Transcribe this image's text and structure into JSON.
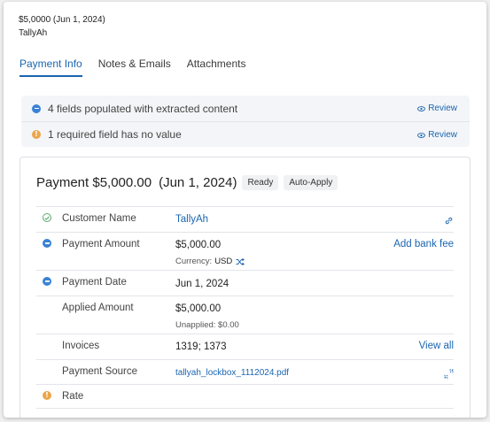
{
  "header": {
    "amount_line": "$5,0000 (Jun 1, 2024)",
    "customer": "TallyAh"
  },
  "tabs": [
    {
      "label": "Payment Info",
      "active": true
    },
    {
      "label": "Notes & Emails",
      "active": false
    },
    {
      "label": "Attachments",
      "active": false
    }
  ],
  "notices": [
    {
      "text": "4 fields populated with extracted content",
      "status": "info",
      "action": "Review"
    },
    {
      "text": "1 required field has no value",
      "status": "warning",
      "action": "Review"
    }
  ],
  "card": {
    "title": "Payment $5,000.00",
    "date": "(Jun 1, 2024)",
    "badges": [
      "Ready",
      "Auto-Apply"
    ]
  },
  "fields": {
    "customer_name": {
      "label": "Customer Name",
      "value": "TallyAh",
      "status": "verified"
    },
    "payment_amount": {
      "label": "Payment Amount",
      "value": "$5,000.00",
      "sub_prefix": "Currency:",
      "sub_value": "USD",
      "action": "Add bank fee",
      "status": "extracted"
    },
    "payment_date": {
      "label": "Payment Date",
      "value": "Jun 1, 2024",
      "status": "extracted"
    },
    "applied_amount": {
      "label": "Applied Amount",
      "value": "$5,000.00",
      "sub": "Unapplied: $0.00"
    },
    "invoices": {
      "label": "Invoices",
      "value": "1319; 1373",
      "action": "View all"
    },
    "payment_source": {
      "label": "Payment Source",
      "value": "tallyah_lockbox_1112024.pdf"
    },
    "rate": {
      "label": "Rate",
      "value": "",
      "status": "missing"
    }
  },
  "colors": {
    "accent": "#1a65b0",
    "info": "#3a82d6",
    "warning": "#eaa64a",
    "success": "#5aa86a"
  }
}
